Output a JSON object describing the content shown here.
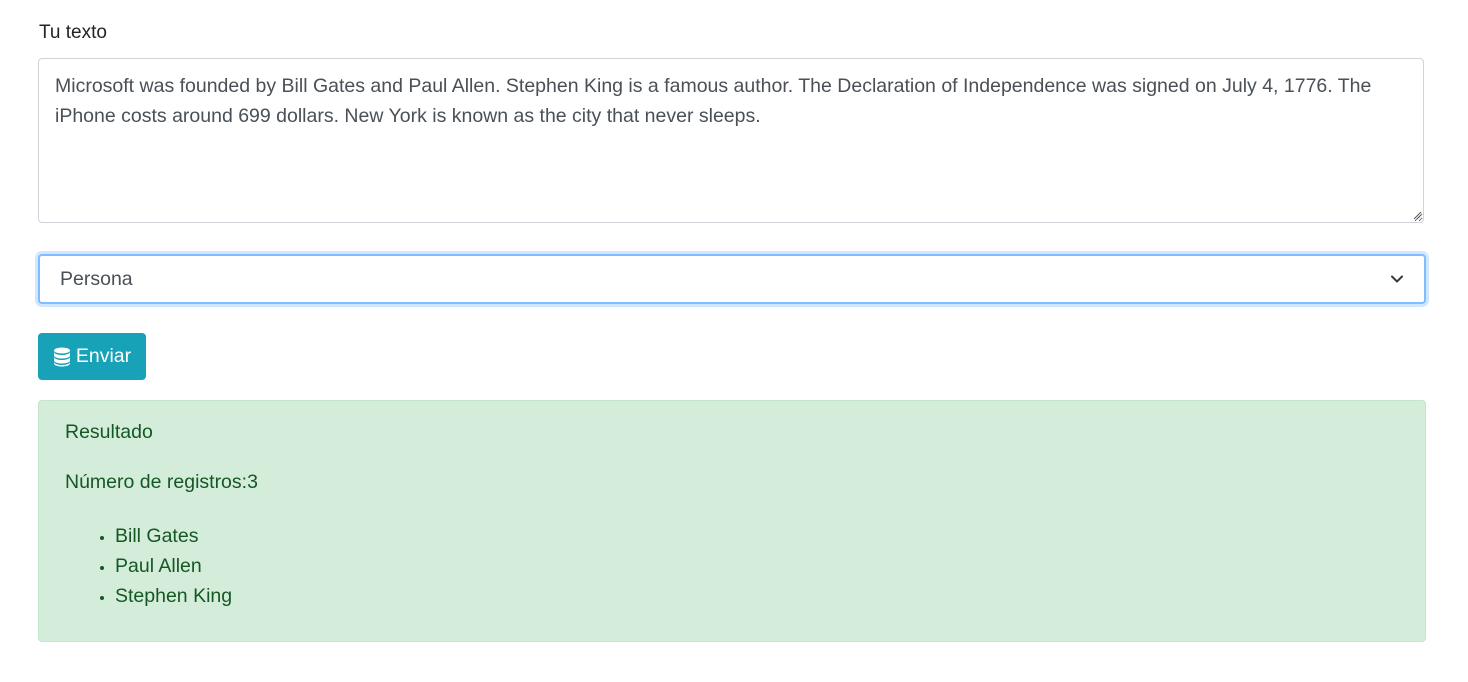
{
  "form": {
    "label": "Tu texto",
    "textarea_value": "Microsoft was founded by Bill Gates and Paul Allen. Stephen King is a famous author. The Declaration of Independence was signed on July 4, 1776. The iPhone costs around 699 dollars. New York is known as the city that never sleeps.",
    "select_value": "Persona",
    "submit_label": "Enviar",
    "submit_icon": "database-icon"
  },
  "result": {
    "title": "Resultado",
    "count_label": "Número de registros:3",
    "items": [
      "Bill Gates",
      "Paul Allen",
      "Stephen King"
    ]
  },
  "colors": {
    "button": "#17a2b8",
    "alert_bg": "#d4edda",
    "alert_text": "#155724",
    "focus_border": "#80bdff"
  }
}
